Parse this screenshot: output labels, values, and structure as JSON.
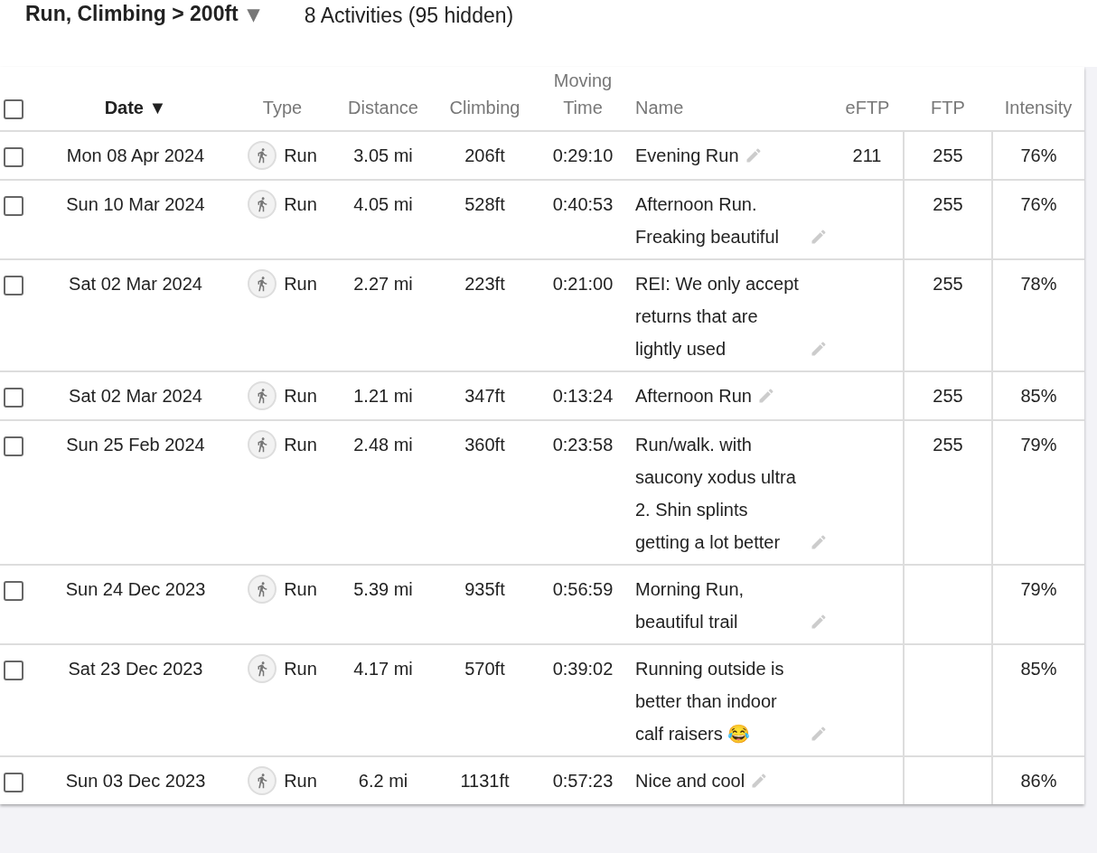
{
  "filter": {
    "label": "Run, Climbing > 200ft",
    "caret": "▾"
  },
  "summary": "8 Activities (95 hidden)",
  "table": {
    "select_all": {
      "checked": false
    },
    "columns": [
      {
        "label": "Date",
        "sorted": true,
        "sort_arrow": "▼"
      },
      {
        "label": "Type",
        "sorted": false
      },
      {
        "label": "Distance",
        "sorted": false
      },
      {
        "label": "Climbing",
        "sorted": false
      },
      {
        "label": "Moving Time",
        "sorted": false
      },
      {
        "label": "Name",
        "sorted": false
      },
      {
        "label": "eFTP",
        "sorted": false
      },
      {
        "label": "FTP",
        "sorted": false
      },
      {
        "label": "Intensity",
        "sorted": false
      }
    ],
    "rows": [
      {
        "checked": false,
        "date": "Mon 08 Apr 2024",
        "type": "Run",
        "distance": "3.05 mi",
        "climbing": "206ft",
        "moving_time": "0:29:10",
        "name": "Evening Run",
        "eftp": "211",
        "ftp": "255",
        "intensity": "76%"
      },
      {
        "checked": false,
        "date": "Sun 10 Mar 2024",
        "type": "Run",
        "distance": "4.05 mi",
        "climbing": "528ft",
        "moving_time": "0:40:53",
        "name": "Afternoon Run. Freaking beautiful",
        "ftp": "255",
        "intensity": "76%"
      },
      {
        "checked": false,
        "date": "Sat 02 Mar 2024",
        "type": "Run",
        "distance": "2.27 mi",
        "climbing": "223ft",
        "moving_time": "0:21:00",
        "name": "REI: We only accept returns that are lightly used",
        "ftp": "255",
        "intensity": "78%"
      },
      {
        "checked": false,
        "date": "Sat 02 Mar 2024",
        "type": "Run",
        "distance": "1.21 mi",
        "climbing": "347ft",
        "moving_time": "0:13:24",
        "name": "Afternoon Run",
        "ftp": "255",
        "intensity": "85%"
      },
      {
        "checked": false,
        "date": "Sun 25 Feb 2024",
        "type": "Run",
        "distance": "2.48 mi",
        "climbing": "360ft",
        "moving_time": "0:23:58",
        "name": "Run/walk. with saucony xodus ultra 2. Shin splints getting a lot better",
        "ftp": "255",
        "intensity": "79%"
      },
      {
        "checked": false,
        "date": "Sun 24 Dec 2023",
        "type": "Run",
        "distance": "5.39 mi",
        "climbing": "935ft",
        "moving_time": "0:56:59",
        "name": "Morning Run, beautiful trail",
        "intensity": "79%"
      },
      {
        "checked": false,
        "date": "Sat 23 Dec 2023",
        "type": "Run",
        "distance": "4.17 mi",
        "climbing": "570ft",
        "moving_time": "0:39:02",
        "name": "Running outside is better than indoor calf raisers 😂",
        "intensity": "85%"
      },
      {
        "checked": false,
        "date": "Sun 03 Dec 2023",
        "type": "Run",
        "distance": "6.2 mi",
        "climbing": "1131ft",
        "moving_time": "0:57:23",
        "name": "Nice and cool",
        "intensity": "86%"
      }
    ]
  }
}
